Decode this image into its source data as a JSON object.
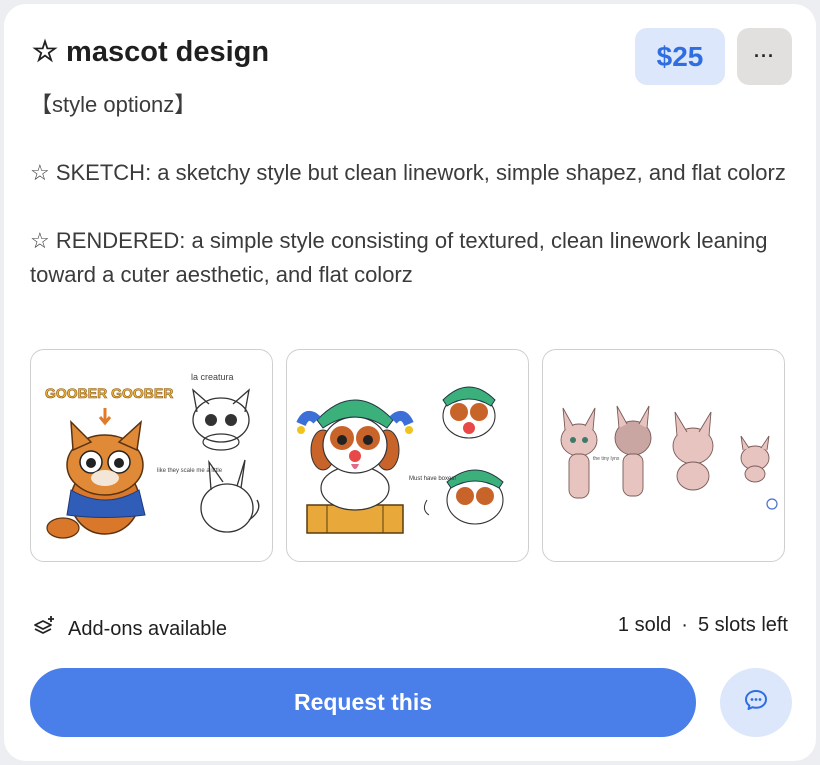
{
  "listing": {
    "title": "☆ mascot design",
    "price": "$25",
    "more_label": "···",
    "description": {
      "heading": "【style optionz】",
      "sketch": "☆ SKETCH: a sketchy style but clean linework, simple shapez, and flat colorz",
      "rendered": "☆ RENDERED: a simple style consisting of textured, clean linework leaning toward a cuter aesthetic, and flat colorz"
    },
    "gallery": {
      "image1": {
        "title_text": "GOOBER GOOBER",
        "note_top": "la creatura",
        "note_side": "like they scale me a little"
      },
      "image2": {
        "note": "Must have boxes!"
      },
      "image3": {
        "note": "the tiny lynx"
      }
    },
    "addons_label": "Add-ons available",
    "sold": "1 sold",
    "separator": "·",
    "slots_left": "5 slots left",
    "request_label": "Request this"
  },
  "colors": {
    "accent": "#4a7ee8",
    "price_bg": "#dde7fb",
    "price_text": "#2f6ee0"
  }
}
